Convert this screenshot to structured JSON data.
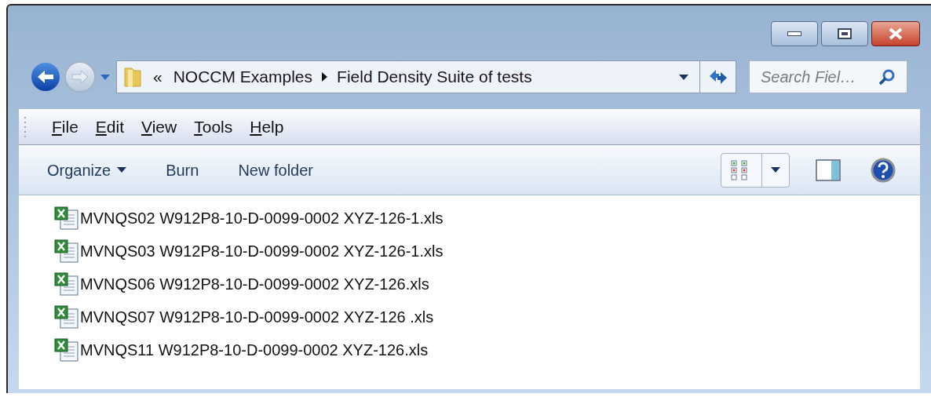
{
  "breadcrumb": {
    "overflow": "«",
    "segments": [
      "NOCCM Examples",
      "Field Density Suite of tests"
    ]
  },
  "search": {
    "placeholder": "Search Fiel…"
  },
  "menu": [
    {
      "accel": "F",
      "rest": "ile"
    },
    {
      "accel": "E",
      "rest": "dit"
    },
    {
      "accel": "V",
      "rest": "iew"
    },
    {
      "accel": "T",
      "rest": "ools"
    },
    {
      "accel": "H",
      "rest": "elp"
    }
  ],
  "toolbar": [
    {
      "label": "Organize",
      "dropdown": true
    },
    {
      "label": "Burn",
      "dropdown": false
    },
    {
      "label": "New folder",
      "dropdown": false
    }
  ],
  "files": [
    {
      "name": "MVNQS02 W912P8-10-D-0099-0002 XYZ-126-1.xls"
    },
    {
      "name": "MVNQS03 W912P8-10-D-0099-0002 XYZ-126-1.xls"
    },
    {
      "name": "MVNQS06 W912P8-10-D-0099-0002 XYZ-126.xls"
    },
    {
      "name": "MVNQS07 W912P8-10-D-0099-0002 XYZ-126 .xls"
    },
    {
      "name": "MVNQS11 W912P8-10-D-0099-0002 XYZ-126.xls"
    }
  ]
}
